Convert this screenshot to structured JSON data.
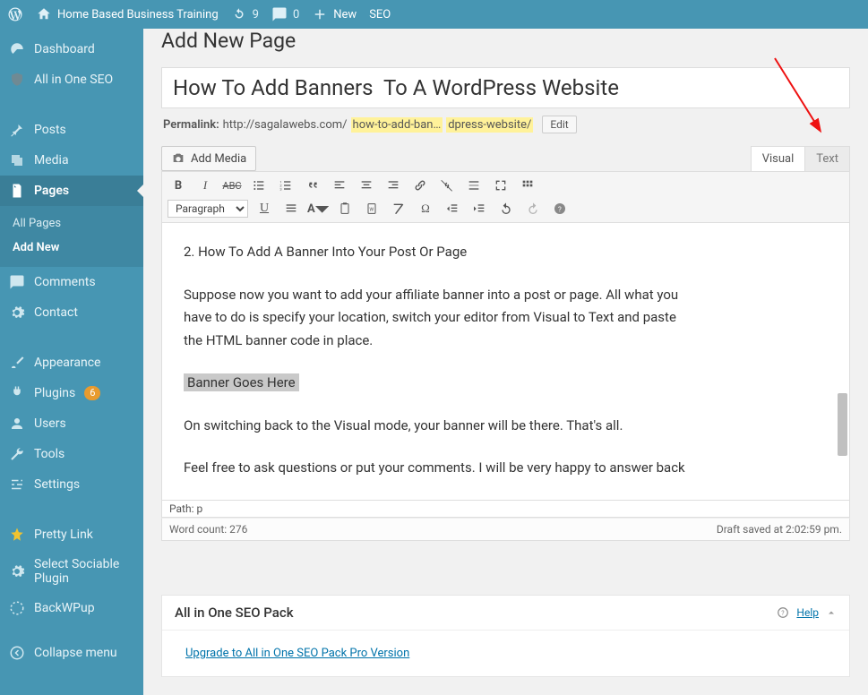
{
  "adminbar": {
    "site_title": "Home Based Business Training",
    "updates_count": "9",
    "comments_count": "0",
    "new_label": "New",
    "seo_label": "SEO"
  },
  "sidebar": {
    "dashboard": "Dashboard",
    "aioseo": "All in One SEO",
    "posts": "Posts",
    "media": "Media",
    "pages": "Pages",
    "pages_sub": {
      "all": "All Pages",
      "add_new": "Add New"
    },
    "comments": "Comments",
    "contact": "Contact",
    "appearance": "Appearance",
    "plugins": "Plugins",
    "plugins_badge": "6",
    "users": "Users",
    "tools": "Tools",
    "settings": "Settings",
    "pretty_link": "Pretty Link",
    "select_sociable": "Select Sociable Plugin",
    "backwpup": "BackWPup",
    "collapse": "Collapse menu"
  },
  "page": {
    "heading": "Add New Page",
    "title_value": "How To Add Banners  To A WordPress Website",
    "permalink_label": "Permalink:",
    "permalink_base": "http://sagalawebs.com/",
    "permalink_slug_a": "how-to-add-ban…",
    "permalink_slug_b": "dpress-website/",
    "edit_btn": "Edit",
    "add_media": "Add Media",
    "tabs": {
      "visual": "Visual",
      "text": "Text"
    },
    "paragraph_select": "Paragraph",
    "content": {
      "h2": "2. How To Add A Banner Into Your Post Or Page",
      "p1": "Suppose now you want to add your affiliate banner into a post or page. All what you have to do is specify your location, switch your editor from Visual to Text and paste the HTML banner code in place.",
      "banner_placeholder": "Banner Goes Here",
      "p2": "On switching back to the Visual mode, your banner will be there. That's all.",
      "p3": "Feel free to ask questions or put your comments. I will be very happy to answer back"
    },
    "path_label": "Path: p",
    "word_count": "Word count: 276",
    "draft_saved": "Draft saved at 2:02:59 pm."
  },
  "seo_panel": {
    "title": "All in One SEO Pack",
    "help": "Help",
    "upgrade": "Upgrade to All in One SEO Pack Pro Version"
  }
}
